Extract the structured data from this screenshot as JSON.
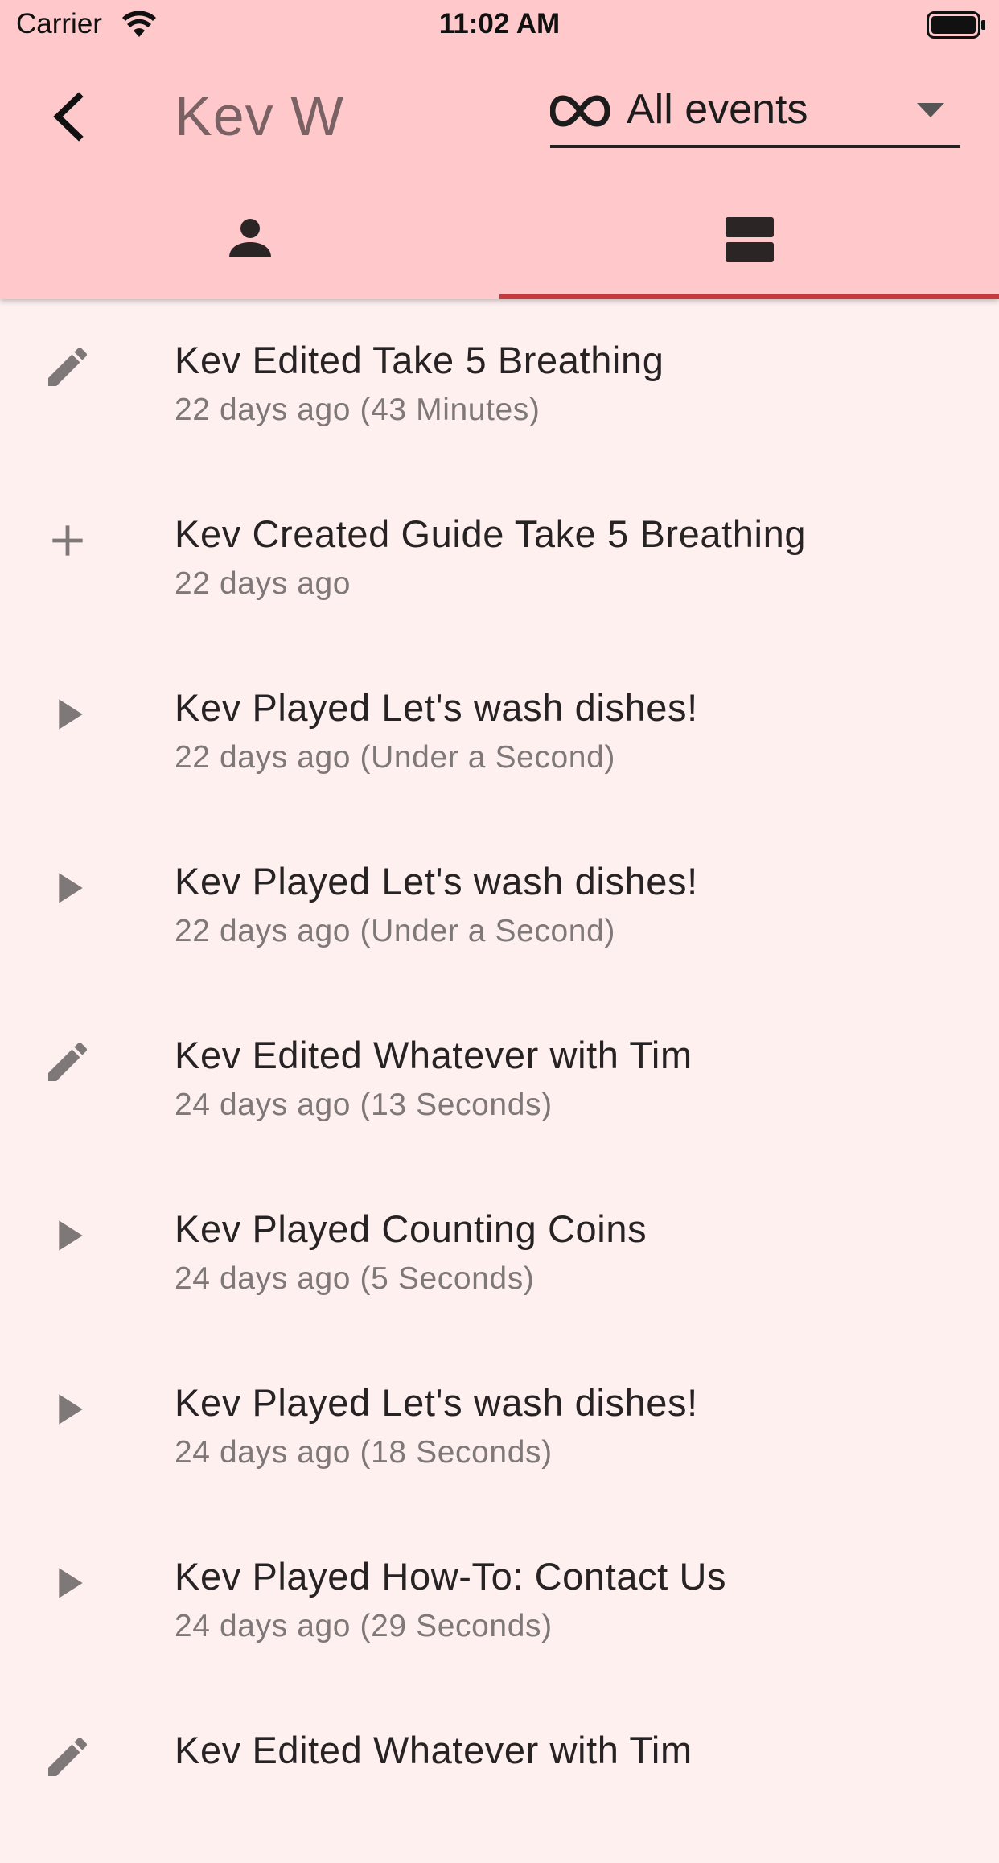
{
  "status_bar": {
    "carrier": "Carrier",
    "time": "11:02 AM"
  },
  "header": {
    "title": "Kev W",
    "back_icon": "chevron-left-icon",
    "filter": {
      "selected": "All events",
      "icon": "infinity-icon",
      "caret": "caret-down-icon"
    }
  },
  "tabs": [
    {
      "name": "profile",
      "icon": "person-icon",
      "selected": false
    },
    {
      "name": "events",
      "icon": "view-agenda-icon",
      "selected": true
    }
  ],
  "colors": {
    "appbar": "#FFC9CB",
    "background": "#FFF0F0",
    "tab_indicator": "#C6393E",
    "icon_gray": "#7F7878"
  },
  "events": [
    {
      "icon": "pencil-icon",
      "title": "Kev Edited Take 5 Breathing",
      "subtitle": "22 days ago (43 Minutes)"
    },
    {
      "icon": "plus-icon",
      "title": "Kev Created Guide Take 5 Breathing",
      "subtitle": "22 days ago"
    },
    {
      "icon": "play-icon",
      "title": "Kev Played Let's wash dishes!",
      "subtitle": "22 days ago (Under a Second)"
    },
    {
      "icon": "play-icon",
      "title": "Kev Played Let's wash dishes!",
      "subtitle": "22 days ago (Under a Second)"
    },
    {
      "icon": "pencil-icon",
      "title": "Kev Edited Whatever with Tim",
      "subtitle": "24 days ago (13 Seconds)"
    },
    {
      "icon": "play-icon",
      "title": "Kev Played Counting Coins",
      "subtitle": "24 days ago (5 Seconds)"
    },
    {
      "icon": "play-icon",
      "title": "Kev Played Let's wash dishes!",
      "subtitle": "24 days ago (18 Seconds)"
    },
    {
      "icon": "play-icon",
      "title": "Kev Played How-To: Contact Us",
      "subtitle": "24 days ago (29 Seconds)"
    },
    {
      "icon": "pencil-icon",
      "title": "Kev Edited Whatever with Tim",
      "subtitle": ""
    }
  ]
}
